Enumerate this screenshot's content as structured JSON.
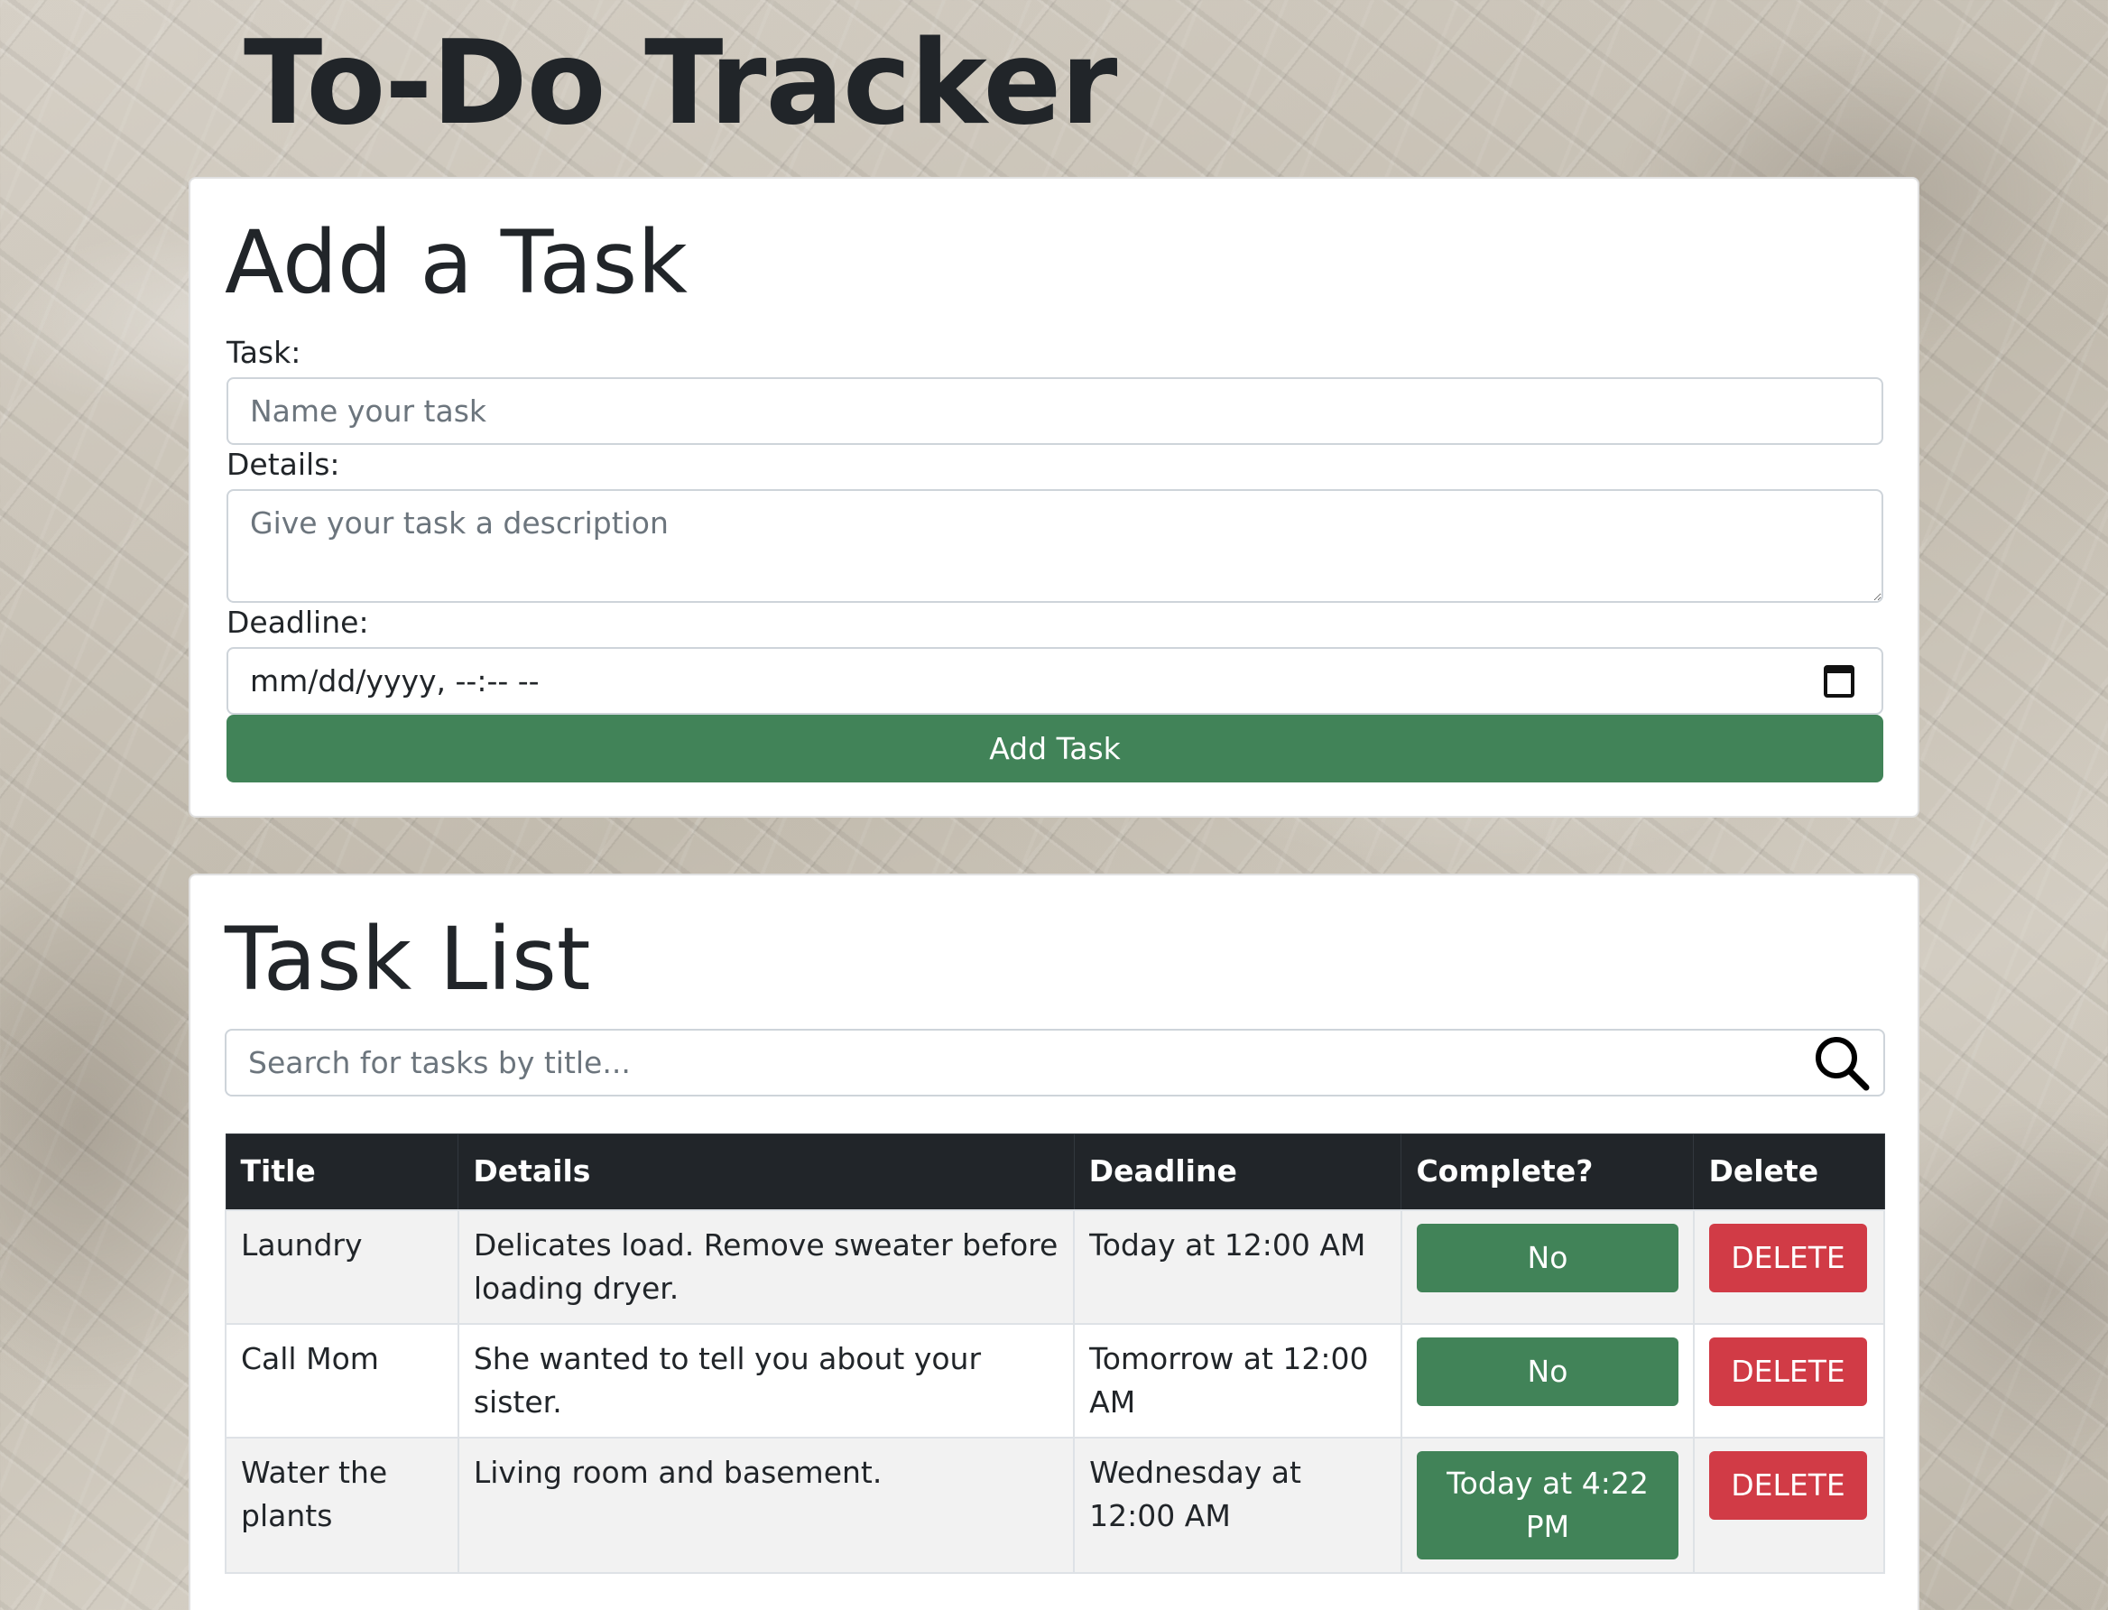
{
  "app": {
    "title": "To-Do Tracker"
  },
  "add_task": {
    "heading": "Add a Task",
    "task_label": "Task:",
    "task_placeholder": "Name your task",
    "details_label": "Details:",
    "details_placeholder": "Give your task a description",
    "deadline_label": "Deadline:",
    "deadline_value": "mm/dd/yyyy, --:-- --",
    "deadline_icon": "calendar-icon",
    "submit_label": "Add Task"
  },
  "task_list": {
    "heading": "Task List",
    "search_placeholder": "Search for tasks by title...",
    "search_icon": "search-icon",
    "columns": [
      "Title",
      "Details",
      "Deadline",
      "Complete?",
      "Delete"
    ],
    "rows": [
      {
        "title": "Laundry",
        "details": "Delicates load. Remove sweater before loading dryer.",
        "deadline": "Today at 12:00 AM",
        "complete": "No",
        "delete": "DELETE"
      },
      {
        "title": "Call Mom",
        "details": "She wanted to tell you about your sister.",
        "deadline": "Tomorrow at 12:00 AM",
        "complete": "No",
        "delete": "DELETE"
      },
      {
        "title": "Water the plants",
        "details": "Living room and basement.",
        "deadline": "Wednesday at 12:00 AM",
        "complete": "Today at 4:22 PM",
        "delete": "DELETE"
      }
    ]
  },
  "colors": {
    "primary_green": "#418358",
    "danger_red": "#d13b46",
    "table_header": "#212529",
    "text": "#212529"
  }
}
